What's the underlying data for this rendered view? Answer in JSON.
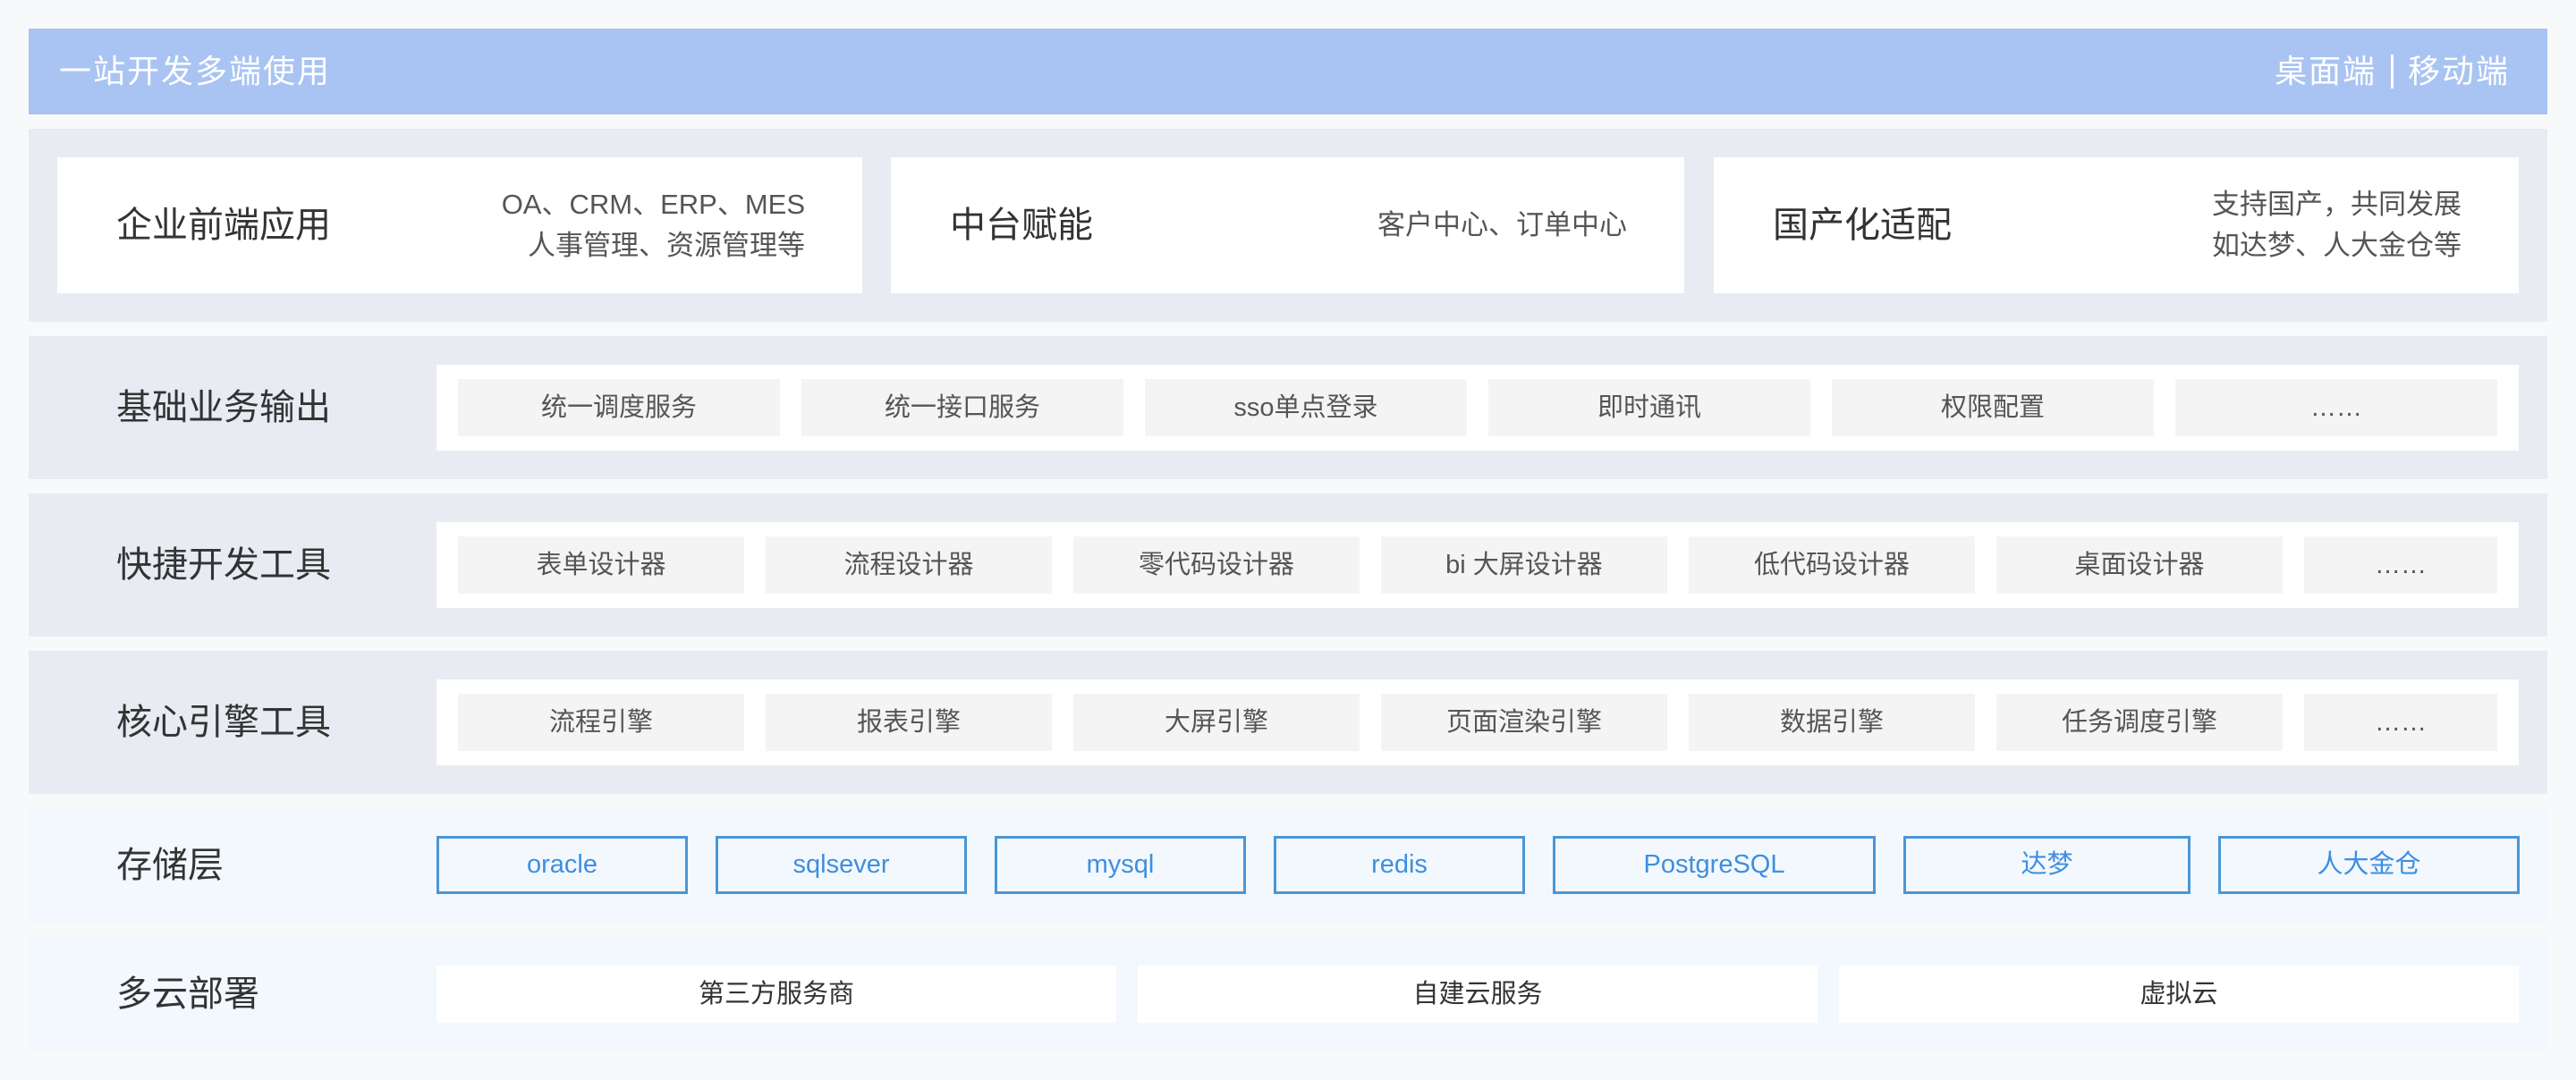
{
  "header": {
    "title": "一站开发多端使用",
    "platforms": [
      "桌面端",
      "移动端"
    ]
  },
  "top_cards": [
    {
      "title": "企业前端应用",
      "desc": [
        "OA、CRM、ERP、MES",
        "人事管理、资源管理等"
      ]
    },
    {
      "title": "中台赋能",
      "desc": [
        "客户中心、订单中心"
      ]
    },
    {
      "title": "国产化适配",
      "desc": [
        "支持国产，共同发展",
        "如达梦、人大金仓等"
      ]
    }
  ],
  "layers": {
    "business": {
      "label": "基础业务输出",
      "items": [
        "统一调度服务",
        "统一接口服务",
        "sso单点登录",
        "即时通讯",
        "权限配置",
        "……"
      ]
    },
    "devtools": {
      "label": "快捷开发工具",
      "items": [
        "表单设计器",
        "流程设计器",
        "零代码设计器",
        "bi 大屏设计器",
        "低代码设计器",
        "桌面设计器",
        "……"
      ]
    },
    "engines": {
      "label": "核心引擎工具",
      "items": [
        "流程引擎",
        "报表引擎",
        "大屏引擎",
        "页面渲染引擎",
        "数据引擎",
        "任务调度引擎",
        "……"
      ]
    },
    "storage": {
      "label": "存储层",
      "items": [
        "oracle",
        "sqlsever",
        "mysql",
        "redis",
        "PostgreSQL",
        "达梦",
        "人大金仓"
      ]
    },
    "cloud": {
      "label": "多云部署",
      "items": [
        "第三方服务商",
        "自建云服务",
        "虚拟云"
      ]
    }
  },
  "colors": {
    "header": "#a9c4f2",
    "band": "#e8ebf2",
    "band_light": "#f3f8fe",
    "storage_accent": "#4a96d6"
  }
}
